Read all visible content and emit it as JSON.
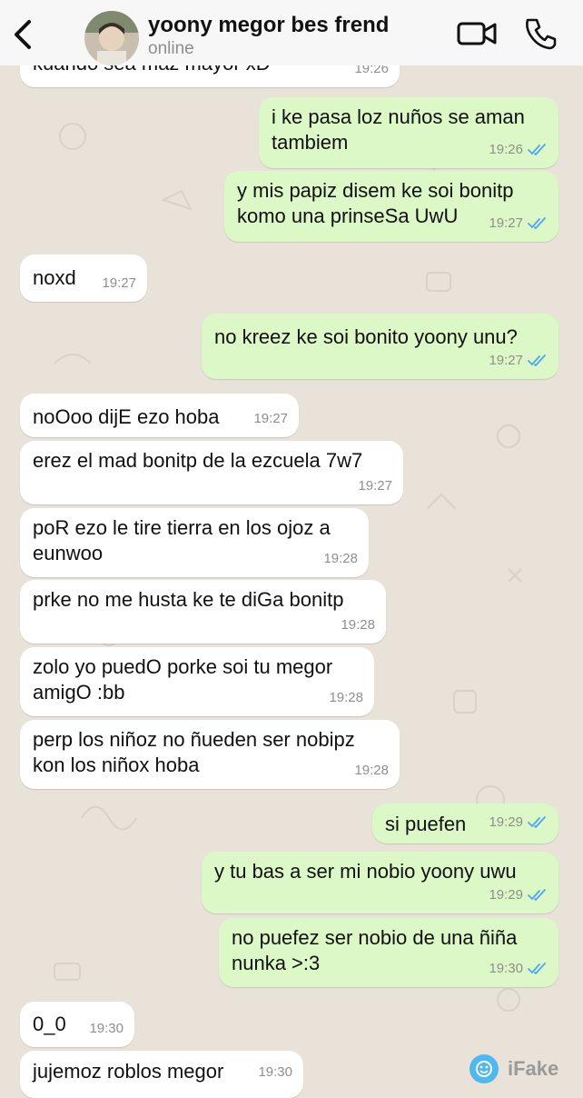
{
  "header": {
    "contact_name": "yoony megor bes frend",
    "status": "online"
  },
  "messages": [
    {
      "dir": "in",
      "text": "kuando sea maz mayor xD",
      "time": "19:26"
    },
    {
      "dir": "out",
      "text": "i ke pasa loz nuños se aman\ntambiem",
      "time": "19:26",
      "read": true
    },
    {
      "dir": "out",
      "text": "y mis papiz disem ke soi bonitp\nkomo una prinseSa UwU",
      "time": "19:27",
      "read": true
    },
    {
      "dir": "in",
      "text": "noxd",
      "time": "19:27"
    },
    {
      "dir": "out",
      "text": "no kreez ke soi bonito yoony unu?",
      "time": "19:27",
      "read": true
    },
    {
      "dir": "in",
      "text": "noOoo dijE ezo hoba",
      "time": "19:27"
    },
    {
      "dir": "in",
      "text": "erez el mad bonitp de la ezcuela 7w7",
      "time": "19:27"
    },
    {
      "dir": "in",
      "text": "poR ezo le tire tierra en los ojoz a\neunwoo",
      "time": "19:28"
    },
    {
      "dir": "in",
      "text": "prke no me husta ke te diGa bonitp",
      "time": "19:28"
    },
    {
      "dir": "in",
      "text": "zolo yo puedO porke soi tu megor\namigO :bb",
      "time": "19:28"
    },
    {
      "dir": "in",
      "text": "perp los niñoz no ñueden ser nobipz\nkon los niñox hoba",
      "time": "19:28"
    },
    {
      "dir": "out",
      "text": "si puefen",
      "time": "19:29",
      "read": true
    },
    {
      "dir": "out",
      "text": "y tu bas a ser mi nobio yoony uwu",
      "time": "19:29",
      "read": true
    },
    {
      "dir": "out",
      "text": "no puefez ser nobio de una ñiña\nnunka >:3",
      "time": "19:30",
      "read": true
    },
    {
      "dir": "in",
      "text": "0_0",
      "time": "19:30"
    },
    {
      "dir": "in",
      "text": "jujemoz roblos megor",
      "time": "19:30"
    }
  ],
  "watermark": "iFake",
  "colors": {
    "incoming_bubble": "#ffffff",
    "outgoing_bubble": "#dcf8c6",
    "accent": "#4fa3f7",
    "background": "#e8e2d9"
  },
  "icons": [
    "back-chevron-icon",
    "video-call-icon",
    "phone-icon",
    "read-ticks-icon",
    "ifake-logo-icon"
  ]
}
